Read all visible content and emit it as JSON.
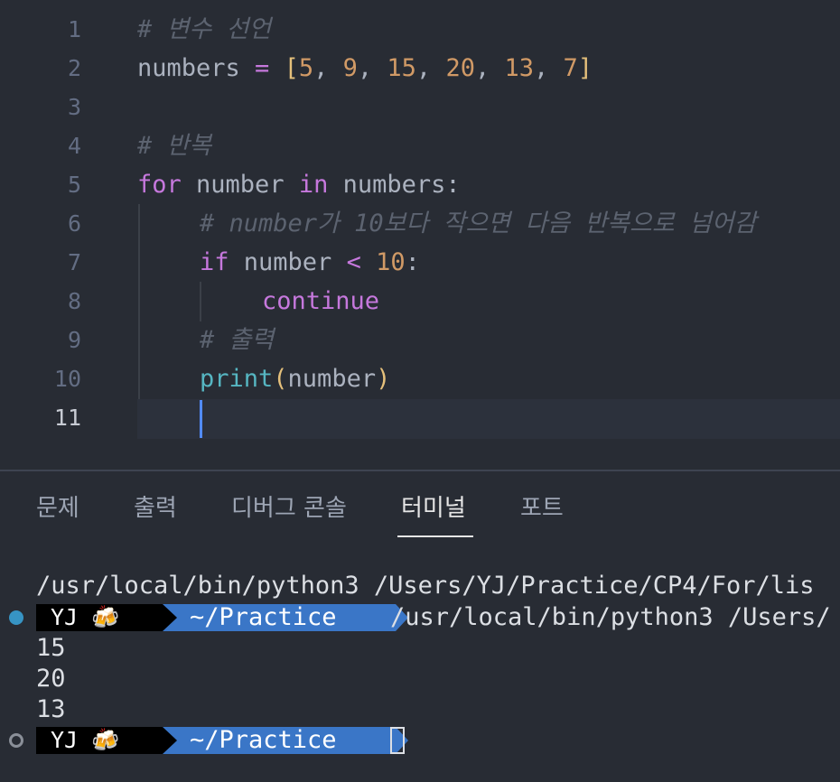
{
  "editor": {
    "line_numbers": [
      "1",
      "2",
      "3",
      "4",
      "5",
      "6",
      "7",
      "8",
      "9",
      "10",
      "11"
    ],
    "lines": [
      {
        "comment": "# 변수 선언"
      },
      {
        "var": "numbers",
        "op": " = ",
        "open": "[",
        "n1": "5",
        "c1": ", ",
        "n2": "9",
        "c2": ", ",
        "n3": "15",
        "c3": ", ",
        "n4": "20",
        "c4": ", ",
        "n5": "13",
        "c5": ", ",
        "n6": "7",
        "close": "]"
      },
      {},
      {
        "comment": "# 반복"
      },
      {
        "kw1": "for",
        "v1": " number ",
        "kw2": "in",
        "v2": " numbers:"
      },
      {
        "comment": "# number가 10보다 작으면 다음 반복으로 넘어감"
      },
      {
        "kw": "if",
        "v": " number ",
        "op": "<",
        "sp": " ",
        "num": "10",
        "colon": ":"
      },
      {
        "kw": "continue"
      },
      {
        "comment": "# 출력"
      },
      {
        "fn": "print",
        "open": "(",
        "arg": "number",
        "close": ")"
      },
      {}
    ]
  },
  "panel": {
    "tabs": [
      "문제",
      "출력",
      "디버그 콘솔",
      "터미널",
      "포트"
    ],
    "active_tab": "터미널"
  },
  "terminal": {
    "command_line": "/usr/local/bin/python3 /Users/YJ/Practice/CP4/For/lis",
    "prompt_user": "YJ 🍻",
    "prompt_dir": "~/Practice",
    "prompt_command": "/usr/local/bin/python3 /Users/",
    "output": [
      "15",
      "20",
      "13"
    ]
  },
  "colors": {
    "background": "#282c34",
    "keyword": "#c678dd",
    "number": "#d19a66",
    "comment": "#5c6370",
    "function": "#56b6c2",
    "bracket": "#e5c07b",
    "prompt_dir_bg": "#3a76c7",
    "status_dot": "#3794c4"
  }
}
